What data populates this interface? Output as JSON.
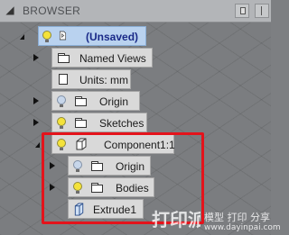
{
  "panel": {
    "title": "BROWSER",
    "toggle_icon": "collapse-triangle-icon",
    "pin_icon": "pin-icon",
    "more_icon": "panel-options-icon"
  },
  "tree": {
    "root": {
      "label": "(Unsaved)",
      "state": "expanded",
      "selected": true
    },
    "named_views": {
      "label": "Named Views",
      "state": "collapsed"
    },
    "units": {
      "label": "Units: mm"
    },
    "origin": {
      "label": "Origin",
      "state": "collapsed",
      "visible": false
    },
    "sketches": {
      "label": "Sketches",
      "state": "collapsed",
      "visible": true
    },
    "component": {
      "label": "Component1:1",
      "state": "expanded",
      "visible": true,
      "children": {
        "origin": {
          "label": "Origin",
          "state": "collapsed",
          "visible": false
        },
        "bodies": {
          "label": "Bodies",
          "state": "collapsed",
          "visible": true
        },
        "extrude": {
          "label": "Extrude1"
        }
      }
    }
  },
  "watermark": {
    "cn_text": "模型 打印 分享",
    "url": "www.dayinpai.com"
  },
  "colors": {
    "highlight": "#e4131b",
    "selected_bg": "#b9d2ef",
    "bulb_on": "#f4e23a"
  }
}
